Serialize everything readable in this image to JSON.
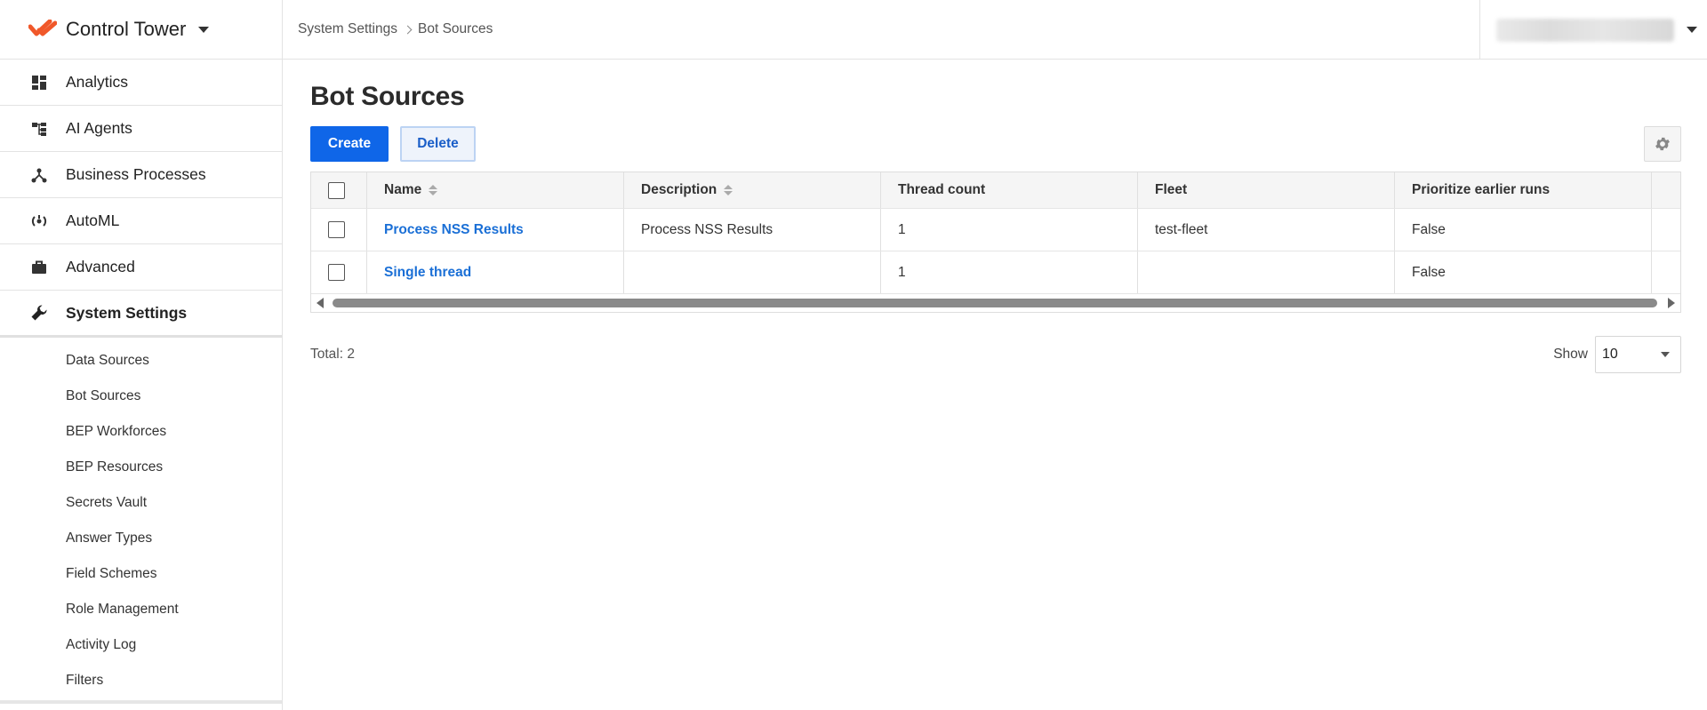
{
  "app": {
    "title": "Control Tower",
    "accent_color": "#f0582a"
  },
  "sidebar": {
    "items": [
      {
        "label": "Analytics",
        "icon": "dashboard-icon"
      },
      {
        "label": "AI Agents",
        "icon": "hierarchy-icon"
      },
      {
        "label": "Business Processes",
        "icon": "process-icon"
      },
      {
        "label": "AutoML",
        "icon": "automl-icon"
      },
      {
        "label": "Advanced",
        "icon": "briefcase-icon"
      },
      {
        "label": "System Settings",
        "icon": "wrench-icon",
        "active": true
      }
    ],
    "subitems": [
      "Data Sources",
      "Bot Sources",
      "BEP Workforces",
      "BEP Resources",
      "Secrets Vault",
      "Answer Types",
      "Field Schemes",
      "Role Management",
      "Activity Log",
      "Filters"
    ]
  },
  "breadcrumb": {
    "parent": "System Settings",
    "current": "Bot Sources"
  },
  "page": {
    "title": "Bot Sources"
  },
  "toolbar": {
    "create_label": "Create",
    "delete_label": "Delete",
    "primary_color": "#0f66e8"
  },
  "table": {
    "columns": [
      "Name",
      "Description",
      "Thread count",
      "Fleet",
      "Prioritize earlier runs"
    ],
    "rows": [
      {
        "name": "Process NSS Results",
        "description": "Process NSS Results",
        "thread_count": "1",
        "fleet": "test-fleet",
        "prioritize": "False"
      },
      {
        "name": "Single thread",
        "description": "",
        "thread_count": "1",
        "fleet": "",
        "prioritize": "False"
      }
    ]
  },
  "footer": {
    "total_label": "Total: 2",
    "show_label": "Show",
    "page_size": "10"
  }
}
